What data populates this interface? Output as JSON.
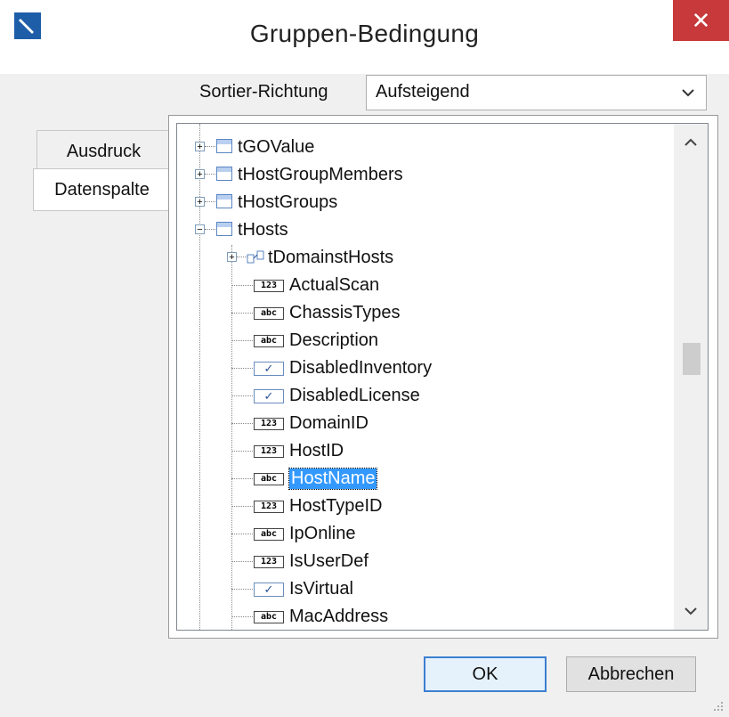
{
  "window": {
    "title": "Gruppen-Bedingung",
    "close_symbol": "✕"
  },
  "sort": {
    "label": "Sortier-Richtung",
    "value": "Aufsteigend"
  },
  "tabs": [
    {
      "label": "Ausdruck",
      "active": false
    },
    {
      "label": "Datenspalte",
      "active": true
    }
  ],
  "tree": {
    "tables": [
      {
        "label": "tGOValue",
        "expanded": false
      },
      {
        "label": "tHostGroupMembers",
        "expanded": false
      },
      {
        "label": "tHostGroups",
        "expanded": false
      },
      {
        "label": "tHosts",
        "expanded": true
      }
    ],
    "relation": {
      "label": "tDomainstHosts"
    },
    "fields": [
      {
        "label": "ActualScan",
        "type": "123",
        "icon": "numeric-type-icon"
      },
      {
        "label": "ChassisTypes",
        "type": "abc",
        "icon": "text-type-icon"
      },
      {
        "label": "Description",
        "type": "abc",
        "icon": "text-type-icon"
      },
      {
        "label": "DisabledInventory",
        "type": "bool",
        "icon": "boolean-type-icon"
      },
      {
        "label": "DisabledLicense",
        "type": "bool",
        "icon": "boolean-type-icon"
      },
      {
        "label": "DomainID",
        "type": "123",
        "icon": "numeric-type-icon"
      },
      {
        "label": "HostID",
        "type": "123",
        "icon": "numeric-type-icon"
      },
      {
        "label": "HostName",
        "type": "abc",
        "icon": "text-type-icon",
        "selected": true
      },
      {
        "label": "HostTypeID",
        "type": "123",
        "icon": "numeric-type-icon"
      },
      {
        "label": "IpOnline",
        "type": "abc",
        "icon": "text-type-icon"
      },
      {
        "label": "IsUserDef",
        "type": "123",
        "icon": "numeric-type-icon"
      },
      {
        "label": "IsVirtual",
        "type": "bool",
        "icon": "boolean-type-icon"
      },
      {
        "label": "MacAddress",
        "type": "abc",
        "icon": "text-type-icon"
      }
    ],
    "type_badges": {
      "123": "123",
      "abc": "abc",
      "bool": "✓"
    }
  },
  "buttons": {
    "ok": "OK",
    "cancel": "Abbrechen"
  },
  "colors": {
    "selection": "#3399ff",
    "close_button": "#c7393a",
    "default_button_border": "#3c7fd1"
  }
}
